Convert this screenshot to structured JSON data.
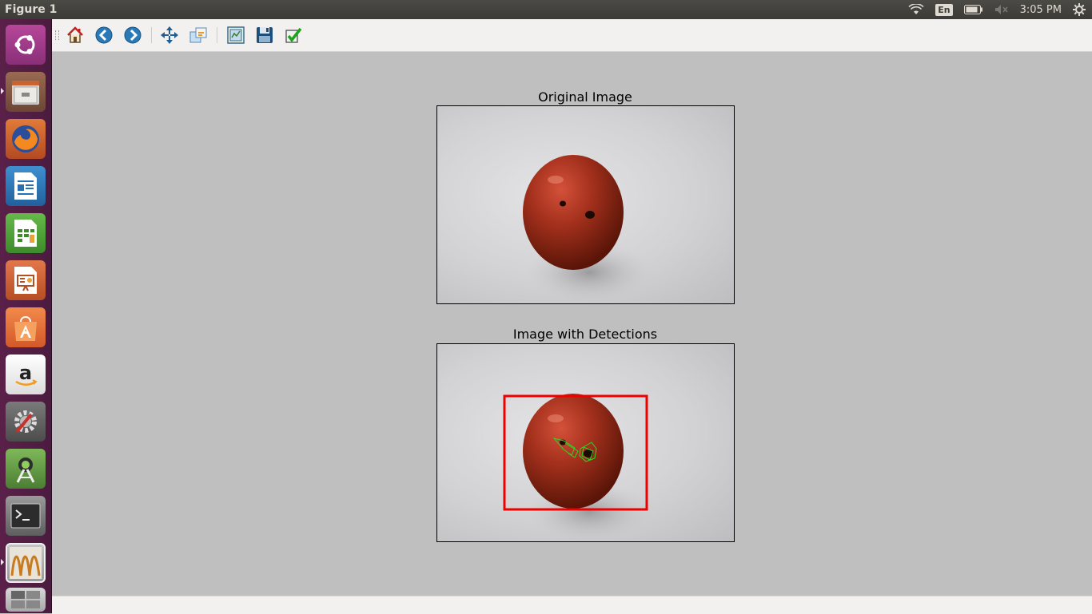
{
  "window": {
    "title": "Figure 1"
  },
  "indicators": {
    "language": "En",
    "time": "3:05 PM"
  },
  "launcher": {
    "items": [
      {
        "name": "ubuntu-dash-icon"
      },
      {
        "name": "files-icon"
      },
      {
        "name": "firefox-icon"
      },
      {
        "name": "libreoffice-writer-icon"
      },
      {
        "name": "libreoffice-calc-icon"
      },
      {
        "name": "libreoffice-impress-icon"
      },
      {
        "name": "software-center-icon"
      },
      {
        "name": "amazon-icon"
      },
      {
        "name": "system-settings-icon"
      },
      {
        "name": "android-studio-icon"
      },
      {
        "name": "terminal-icon"
      },
      {
        "name": "matplotlib-figure-icon"
      },
      {
        "name": "workspace-switcher-icon"
      }
    ]
  },
  "toolbar": {
    "buttons": [
      {
        "name": "home-icon"
      },
      {
        "name": "back-icon"
      },
      {
        "name": "forward-icon"
      },
      {
        "name": "pan-icon"
      },
      {
        "name": "zoom-icon"
      },
      {
        "name": "configure-subplots-icon"
      },
      {
        "name": "save-icon"
      },
      {
        "name": "edit-parameters-icon"
      }
    ]
  },
  "figure": {
    "subplots": [
      {
        "title": "Original Image"
      },
      {
        "title": "Image with Detections"
      }
    ],
    "colors": {
      "detection_box": "#ee0000",
      "contour": "#22dd22"
    }
  }
}
